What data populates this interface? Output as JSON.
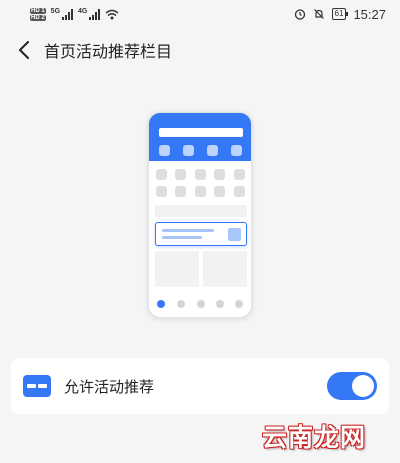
{
  "status_bar": {
    "hd1": "HD 1",
    "hd2": "HD 2",
    "net1": "5G",
    "net2": "4G",
    "battery": "61",
    "time": "15:27"
  },
  "header": {
    "title": "首页活动推荐栏目",
    "back_icon": "chevron-left-icon"
  },
  "setting": {
    "label": "允许活动推荐",
    "enabled": true,
    "icon": "card-icon"
  },
  "watermark": "云南龙网",
  "colors": {
    "accent": "#3478f6",
    "background": "#f5f5f5",
    "card": "#ffffff"
  }
}
